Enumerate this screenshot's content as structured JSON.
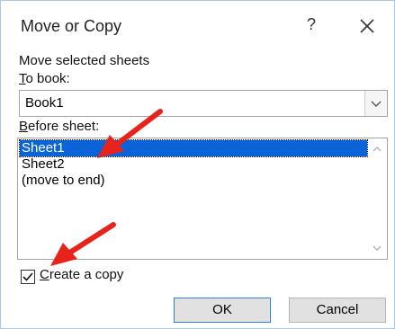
{
  "window": {
    "title": "Move or Copy"
  },
  "titlebar": {
    "help_glyph": "?",
    "close_icon": "close-icon"
  },
  "labels": {
    "move_selected": "Move selected sheets",
    "to_book_prefix": "T",
    "to_book_rest": "o book:",
    "before_sheet_prefix": "B",
    "before_sheet_rest": "efore sheet:"
  },
  "to_book": {
    "value": "Book1"
  },
  "sheets": [
    {
      "label": "Sheet1",
      "selected": true
    },
    {
      "label": "Sheet2",
      "selected": false
    },
    {
      "label": "(move to end)",
      "selected": false
    }
  ],
  "create_copy": {
    "checked": true,
    "prefix": "C",
    "rest": "reate a copy"
  },
  "buttons": {
    "ok": "OK",
    "cancel": "Cancel"
  },
  "colors": {
    "selection": "#0a64d7",
    "annotation_arrow": "#e8231c",
    "dialog_border": "#a9c8e6"
  }
}
